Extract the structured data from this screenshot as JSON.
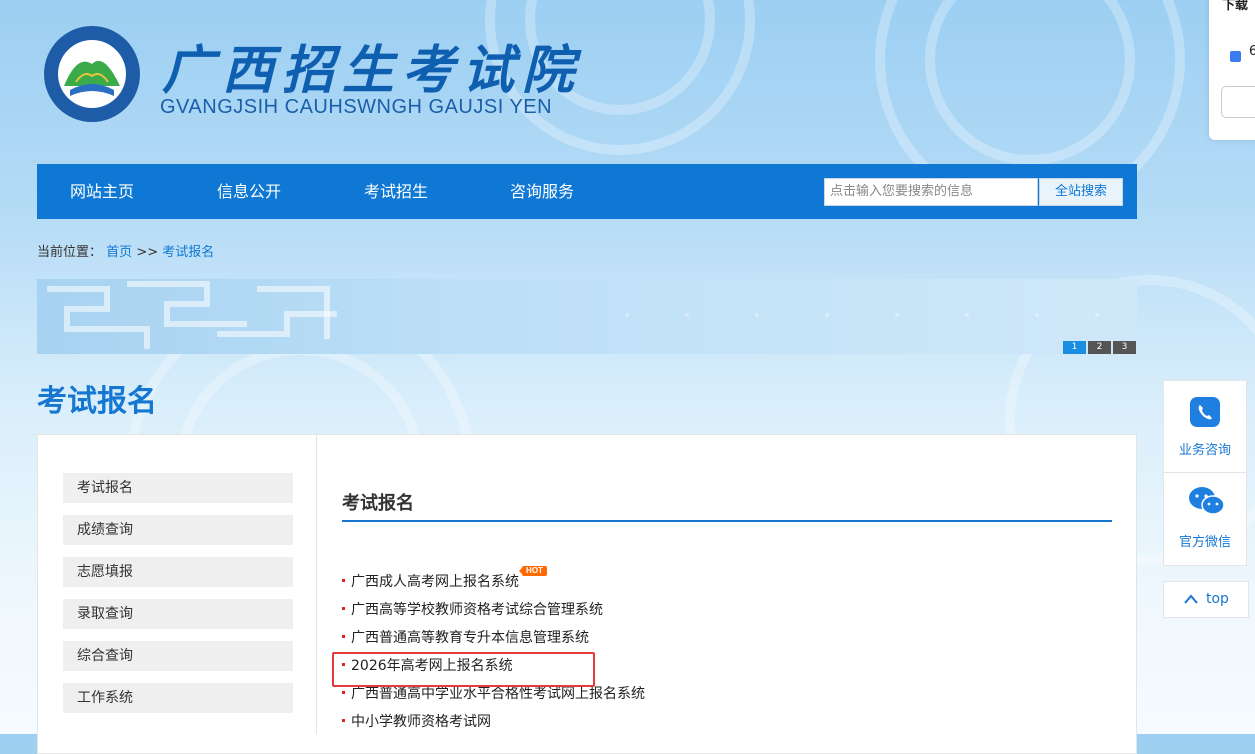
{
  "header": {
    "site_name_cn": "广西招生考试院",
    "site_name_en": "GVANGJSIH CAUHSWNGH GAUJSI YEN",
    "emblem_text": "GVANGJSIH CAUHSWNGH GAUJSI YEN"
  },
  "nav": {
    "items": [
      "网站主页",
      "信息公开",
      "考试招生",
      "咨询服务"
    ],
    "search_placeholder": "点击输入您要搜索的信息",
    "search_button": "全站搜索"
  },
  "breadcrumb": {
    "prefix": "当前位置：",
    "home": "首页",
    "sep": ">>",
    "current": "考试报名"
  },
  "banner": {
    "pages": [
      "1",
      "2",
      "3"
    ],
    "active_page": 1
  },
  "page_title": "考试报名",
  "sidebar": {
    "items": [
      "考试报名",
      "成绩查询",
      "志愿填报",
      "录取查询",
      "综合查询",
      "工作系统"
    ]
  },
  "section": {
    "title": "考试报名",
    "links": [
      "广西成人高考网上报名系统",
      "广西高等学校教师资格考试综合管理系统",
      "广西普通高等教育专升本信息管理系统",
      "2026年高考网上报名系统",
      "广西普通高中学业水平合格性考试网上报名系统",
      "中小学教师资格考试网"
    ],
    "hot_badge": "HOT"
  },
  "popup": {
    "title": "下载",
    "number": "6"
  },
  "float_tools": {
    "consult_label": "业务咨询",
    "wechat_label": "官方微信",
    "top_label": "top"
  },
  "colors": {
    "primary": "#0f78d4",
    "title_blue": "#1677d2",
    "highlight_red": "#e8393b",
    "hot_orange": "#ff6a00"
  }
}
